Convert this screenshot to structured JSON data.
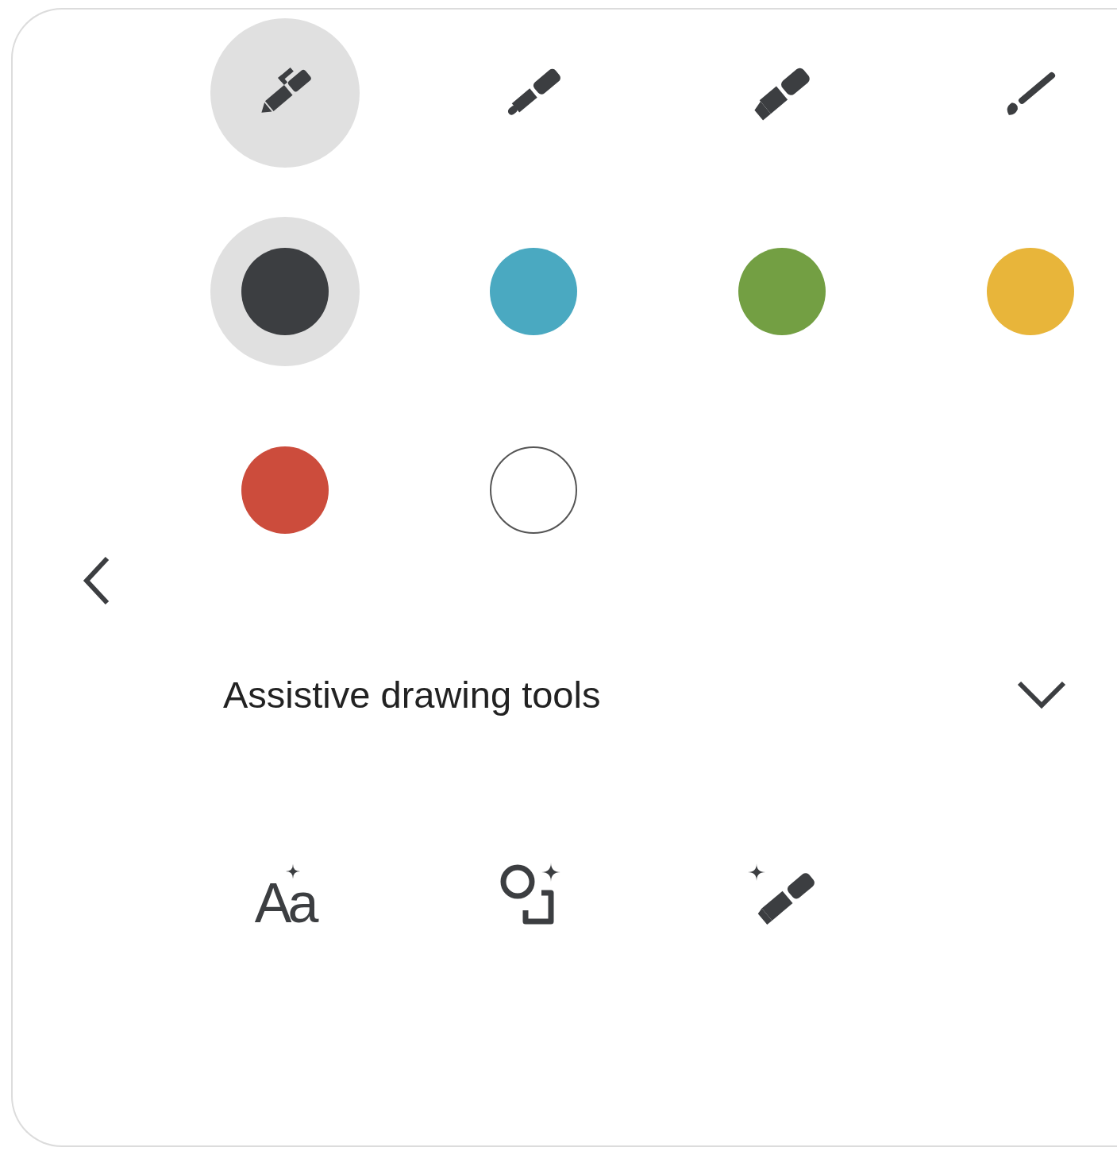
{
  "tools": [
    {
      "kind": "pen",
      "selected": true
    },
    {
      "kind": "marker",
      "selected": false
    },
    {
      "kind": "highlighter",
      "selected": false
    },
    {
      "kind": "brush",
      "selected": false
    }
  ],
  "colors": [
    {
      "color": "#3c3e41",
      "selected": true
    },
    {
      "color": "#4aa9c1",
      "selected": false
    },
    {
      "color": "#739f43",
      "selected": false
    },
    {
      "color": "#e8b53a",
      "selected": false
    },
    {
      "color": "#cc4c3c",
      "selected": false
    },
    {
      "color": "#ffffff",
      "selected": false
    }
  ],
  "assistive": {
    "title": "Assistive drawing tools",
    "expanded": false
  },
  "assistive_tools": [
    {
      "kind": "text",
      "label": "Aa"
    },
    {
      "kind": "shape"
    },
    {
      "kind": "pen"
    }
  ]
}
